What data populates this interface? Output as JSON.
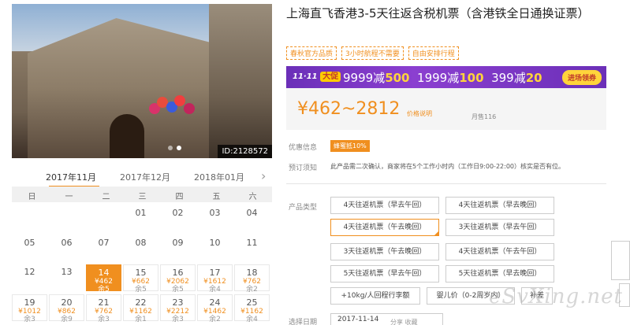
{
  "gallery": {
    "image_id": "ID:2128572"
  },
  "calendar": {
    "months": [
      "2017年11月",
      "2017年12月",
      "2018年01月"
    ],
    "weekdays": [
      "日",
      "一",
      "二",
      "三",
      "四",
      "五",
      "六"
    ],
    "rows": [
      [
        {
          "d": "",
          "p": "",
          "r": ""
        },
        {
          "d": "",
          "p": "",
          "r": ""
        },
        {
          "d": "",
          "p": "",
          "r": ""
        },
        {
          "d": "01",
          "p": "",
          "r": ""
        },
        {
          "d": "02",
          "p": "",
          "r": ""
        },
        {
          "d": "03",
          "p": "",
          "r": ""
        },
        {
          "d": "04",
          "p": "",
          "r": ""
        }
      ],
      [
        {
          "d": "05",
          "p": "",
          "r": ""
        },
        {
          "d": "06",
          "p": "",
          "r": ""
        },
        {
          "d": "07",
          "p": "",
          "r": ""
        },
        {
          "d": "08",
          "p": "",
          "r": ""
        },
        {
          "d": "09",
          "p": "",
          "r": ""
        },
        {
          "d": "10",
          "p": "",
          "r": ""
        },
        {
          "d": "11",
          "p": "",
          "r": ""
        }
      ],
      [
        {
          "d": "12",
          "p": "",
          "r": ""
        },
        {
          "d": "13",
          "p": "",
          "r": ""
        },
        {
          "d": "14",
          "p": "¥462",
          "r": "余5",
          "sel": true
        },
        {
          "d": "15",
          "p": "¥662",
          "r": "余5"
        },
        {
          "d": "16",
          "p": "¥2062",
          "r": "余5"
        },
        {
          "d": "17",
          "p": "¥1612",
          "r": "余4"
        },
        {
          "d": "18",
          "p": "¥762",
          "r": "余2"
        }
      ],
      [
        {
          "d": "19",
          "p": "¥1012",
          "r": "余3"
        },
        {
          "d": "20",
          "p": "¥862",
          "r": "余9"
        },
        {
          "d": "21",
          "p": "¥762",
          "r": "余3"
        },
        {
          "d": "22",
          "p": "¥1162",
          "r": "余1"
        },
        {
          "d": "23",
          "p": "¥2212",
          "r": "余3"
        },
        {
          "d": "24",
          "p": "¥1462",
          "r": "余2"
        },
        {
          "d": "25",
          "p": "¥1162",
          "r": "余4"
        }
      ]
    ]
  },
  "product": {
    "title": "上海直飞香港3-5天往返含税机票（含港铁全日通换证票）",
    "tags": [
      "春秋官方品质",
      "3小时航程不需要",
      "自由安排行程"
    ]
  },
  "promo": {
    "badge": "11·11",
    "badge_sub": "大促",
    "offers": [
      {
        "a": "9999减",
        "b": "500"
      },
      {
        "a": "1999减",
        "b": "100"
      },
      {
        "a": "399减",
        "b": "20"
      }
    ],
    "coupon": "进场领券"
  },
  "price": {
    "range": "¥462~2812",
    "explain": "价格说明",
    "sold": "月售116"
  },
  "info": {
    "discount_label": "优惠信息",
    "discount_badge": "蜂蜜抵10%",
    "notice_label": "预订须知",
    "notice_text": "此产品需二次确认，商家将在5个工作小时内（工作日9:00-22:00）核实是否有位。",
    "type_label": "产品类型",
    "date_label": "选择日期",
    "date_value": "2017-11-14"
  },
  "options": [
    "4天往返机票（早去午回）",
    "4天往返机票（早去晚回）",
    "4天往返机票（午去晚回）",
    "3天往返机票（早去午回）",
    "3天往返机票（午去晚回）",
    "4天往返机票（午去午回）",
    "5天往返机票（早去午回）",
    "5天往返机票（早去晚回）",
    "+10kg/人回程行李额",
    "婴儿价（0-2周岁内）",
    "补差"
  ],
  "bottom_strip": "分享 收藏",
  "watermark": "eSvXing.net",
  "colors": {
    "accent": "#f08f1f",
    "promo_purple": "#7b35c2"
  }
}
